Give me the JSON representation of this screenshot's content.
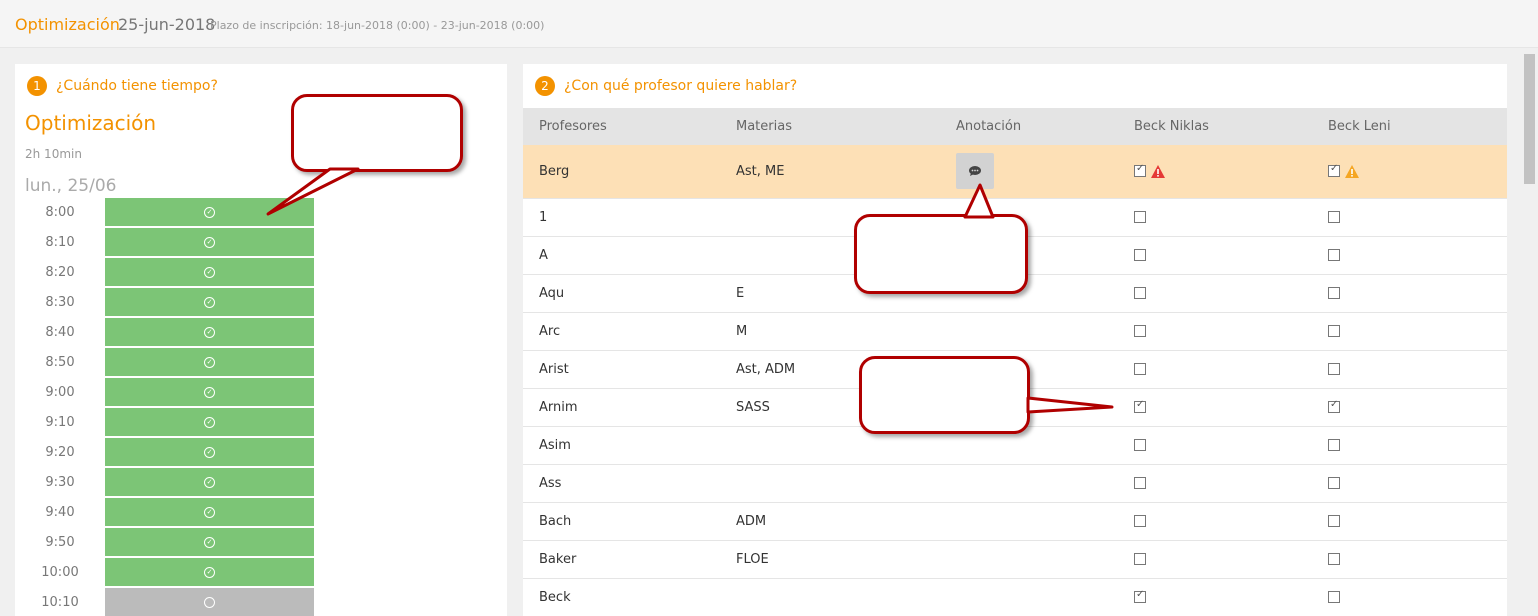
{
  "header": {
    "title": "Optimización",
    "date": "25-jun-2018",
    "period": "Plazo de inscripción: 18-jun-2018 (0:00) - 23-jun-2018 (0:00)"
  },
  "left": {
    "step_num": "1",
    "question": "¿Cuándo tiene tiempo?",
    "title": "Optimización",
    "duration": "2h 10min",
    "day": "lun., 25/06",
    "slots": [
      {
        "time": "8:00",
        "available": true
      },
      {
        "time": "8:10",
        "available": true
      },
      {
        "time": "8:20",
        "available": true
      },
      {
        "time": "8:30",
        "available": true
      },
      {
        "time": "8:40",
        "available": true
      },
      {
        "time": "8:50",
        "available": true
      },
      {
        "time": "9:00",
        "available": true
      },
      {
        "time": "9:10",
        "available": true
      },
      {
        "time": "9:20",
        "available": true
      },
      {
        "time": "9:30",
        "available": true
      },
      {
        "time": "9:40",
        "available": true
      },
      {
        "time": "9:50",
        "available": true
      },
      {
        "time": "10:00",
        "available": true
      },
      {
        "time": "10:10",
        "available": false
      }
    ]
  },
  "right": {
    "step_num": "2",
    "question": "¿Con qué profesor quiere hablar?",
    "columns": [
      "Profesores",
      "Materias",
      "Anotación",
      "Beck Niklas",
      "Beck Leni"
    ],
    "rows": [
      {
        "teacher": "Berg",
        "subjects": "Ast, ME",
        "annotation": true,
        "c1": true,
        "c2": true,
        "warn1": "red",
        "warn2": "orange",
        "highlight": true
      },
      {
        "teacher": "1",
        "subjects": "",
        "c1": false,
        "c2": false
      },
      {
        "teacher": "A",
        "subjects": "",
        "c1": false,
        "c2": false
      },
      {
        "teacher": "Aqu",
        "subjects": "E",
        "c1": false,
        "c2": false
      },
      {
        "teacher": "Arc",
        "subjects": "M",
        "c1": false,
        "c2": false
      },
      {
        "teacher": "Arist",
        "subjects": "Ast, ADM",
        "c1": false,
        "c2": false
      },
      {
        "teacher": "Arnim",
        "subjects": "SASS",
        "c1": true,
        "c2": true
      },
      {
        "teacher": "Asim",
        "subjects": "",
        "c1": false,
        "c2": false
      },
      {
        "teacher": "Ass",
        "subjects": "",
        "c1": false,
        "c2": false
      },
      {
        "teacher": "Bach",
        "subjects": "ADM",
        "c1": false,
        "c2": false
      },
      {
        "teacher": "Baker",
        "subjects": "FLOE",
        "c1": false,
        "c2": false
      },
      {
        "teacher": "Beck",
        "subjects": "",
        "c1": true,
        "c2": false
      }
    ]
  },
  "colors": {
    "accent": "#f39200",
    "available": "#7cc576",
    "unavailable": "#bbbbbb",
    "highlight": "#fde0b6",
    "callout_border": "#b00000",
    "warn_red": "#e53935",
    "warn_orange": "#f5a623"
  },
  "icons": {
    "available": "check-circle-icon",
    "unavailable": "circle-icon",
    "annotation": "comment-icon",
    "warning": "warning-icon"
  }
}
